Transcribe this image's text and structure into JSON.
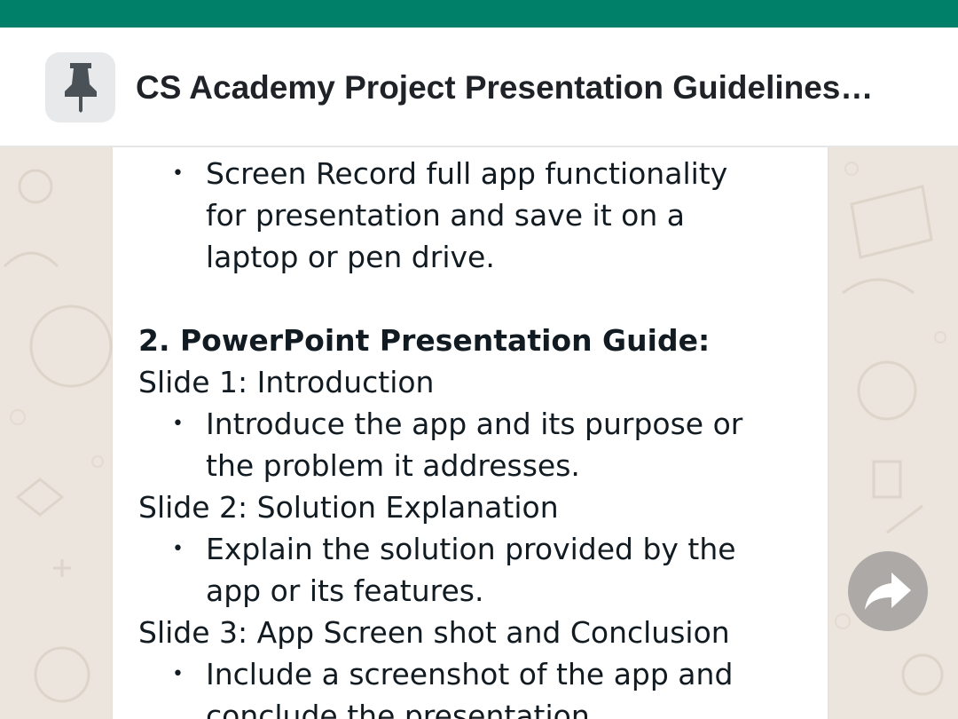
{
  "pinned": {
    "title": "CS Academy Project Presentation Guidelines…",
    "icon": "pin-icon"
  },
  "message": {
    "lines": [
      {
        "kind": "bullet",
        "text": "Screen Record full app functionality"
      },
      {
        "kind": "cont",
        "text": "for presentation and save it on a"
      },
      {
        "kind": "cont",
        "text": "laptop or pen drive."
      },
      {
        "kind": "blank",
        "text": ""
      },
      {
        "kind": "heading",
        "text": "2. PowerPoint Presentation Guide:"
      },
      {
        "kind": "plain",
        "text": "Slide 1: Introduction"
      },
      {
        "kind": "bullet",
        "text": "Introduce the app and its purpose or"
      },
      {
        "kind": "cont",
        "text": "the problem it addresses."
      },
      {
        "kind": "plain",
        "text": "Slide 2: Solution Explanation"
      },
      {
        "kind": "bullet",
        "text": "Explain the solution provided by the"
      },
      {
        "kind": "cont",
        "text": "app or its features."
      },
      {
        "kind": "plain",
        "text": "Slide 3: App Screen shot and Conclusion"
      },
      {
        "kind": "bullet",
        "text": "Include a screenshot of the app and"
      },
      {
        "kind": "cont",
        "text": "conclude the presentation."
      }
    ],
    "bullet_char": "•"
  },
  "forward": {
    "icon": "forward-arrow-icon"
  },
  "colors": {
    "status_bar": "#008069",
    "wallpaper": "#ece5dd",
    "card": "#ffffff",
    "text": "#111b21"
  }
}
